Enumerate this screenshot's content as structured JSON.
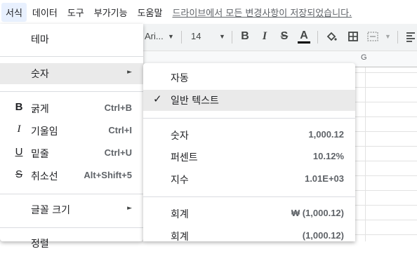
{
  "menubar": {
    "items": [
      "서식",
      "데이터",
      "도구",
      "부가기능",
      "도움말"
    ],
    "save_status": "드라이브에서 모든 변경사항이 저장되었습니다."
  },
  "toolbar": {
    "font_name": "Ari...",
    "font_size": "14",
    "bold_icon": "B",
    "italic_icon": "I",
    "strike_icon": "S",
    "text_color_icon": "A"
  },
  "grid": {
    "column_label": "G"
  },
  "format_menu": {
    "theme": "테마",
    "number": "숫자",
    "bold": {
      "label": "굵게",
      "shortcut": "Ctrl+B",
      "icon": "B"
    },
    "italic": {
      "label": "기울임",
      "shortcut": "Ctrl+I",
      "icon": "I"
    },
    "underline": {
      "label": "밑줄",
      "shortcut": "Ctrl+U",
      "icon": "U"
    },
    "strikethrough": {
      "label": "취소선",
      "shortcut": "Alt+Shift+5",
      "icon": "S"
    },
    "font_size": "글꼴 크기",
    "align": "정렬"
  },
  "number_submenu": {
    "automatic": "자동",
    "plain_text": "일반 텍스트",
    "number": {
      "label": "숫자",
      "example": "1,000.12"
    },
    "percent": {
      "label": "퍼센트",
      "example": "10.12%"
    },
    "scientific": {
      "label": "지수",
      "example": "1.01E+03"
    },
    "accounting": {
      "label": "회계",
      "example": "₩ (1,000.12)"
    },
    "financial": {
      "label": "회계",
      "example": "(1,000.12)"
    }
  }
}
